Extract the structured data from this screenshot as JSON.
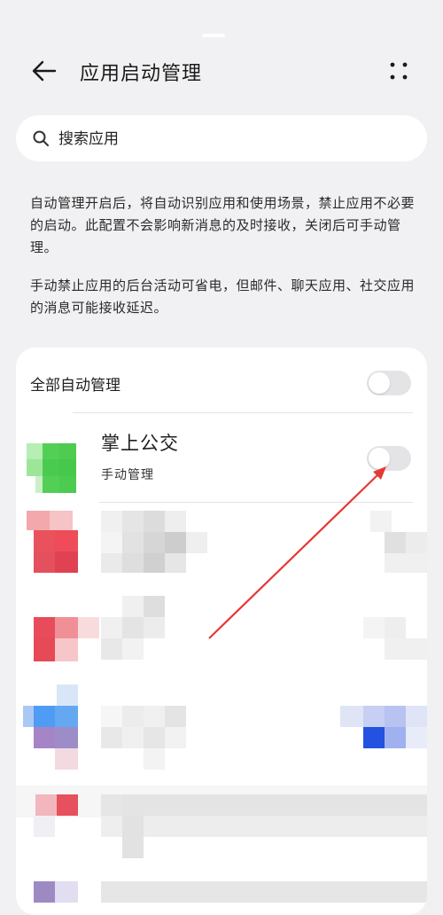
{
  "header": {
    "title": "应用启动管理"
  },
  "search": {
    "placeholder": "搜索应用"
  },
  "description": {
    "paragraph1": "自动管理开启后，将自动识别应用和使用场景，禁止应用不必要的启动。此配置不会影响新消息的及时接收，关闭后可手动管理。",
    "paragraph2": "手动禁止应用的后台活动可省电，但邮件、聊天应用、社交应用的消息可能接收延迟。"
  },
  "list": {
    "all_auto_label": "全部自动管理",
    "all_auto_enabled": false,
    "apps": [
      {
        "name": "掌上公交",
        "status": "手动管理",
        "enabled": false
      }
    ]
  },
  "colors": {
    "background": "#f1f1f3",
    "card": "#ffffff",
    "toggle_off": "#e4e4e6",
    "annotation_arrow": "#e53935"
  }
}
